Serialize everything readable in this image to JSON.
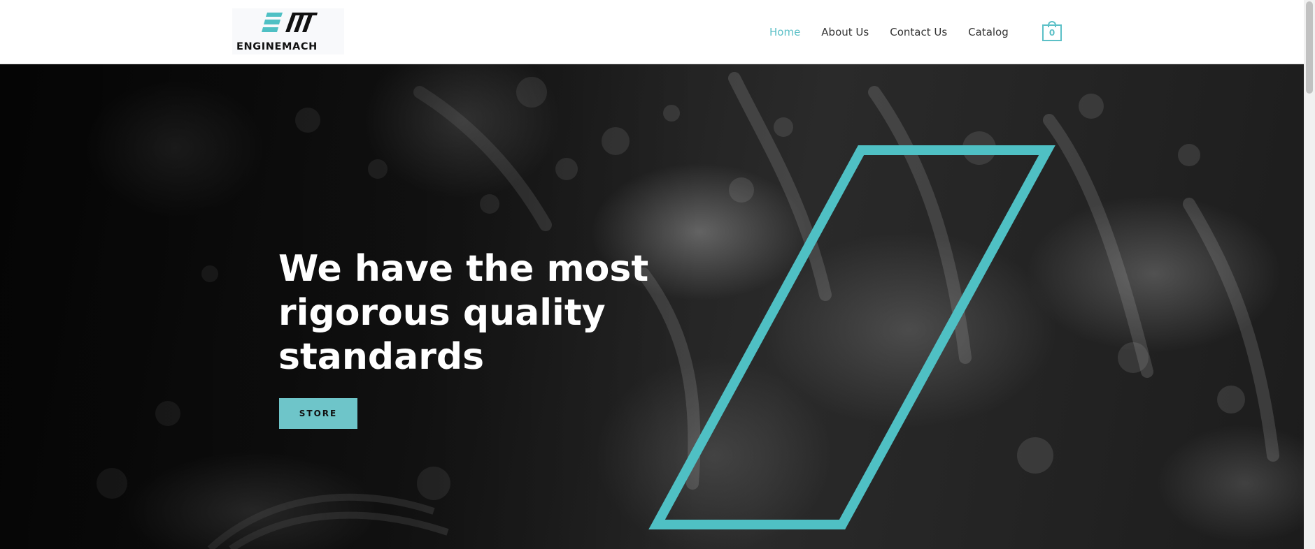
{
  "brand": {
    "name": "ENGINEMACH",
    "accent_color": "#5cc0c7",
    "logo_icon": "em-logo-mark"
  },
  "nav": {
    "items": [
      {
        "label": "Home",
        "active": true
      },
      {
        "label": "About Us",
        "active": false
      },
      {
        "label": "Contact Us",
        "active": false
      },
      {
        "label": "Catalog",
        "active": false
      }
    ],
    "cart_count": "0",
    "cart_icon": "shopping-bag-icon"
  },
  "hero": {
    "title": "We have the most rigorous quality standards",
    "button_label": "STORE",
    "button_color": "#6ec5c9",
    "outline_color": "#4fc0c4",
    "background": "dark grayscale engine machinery photo"
  }
}
